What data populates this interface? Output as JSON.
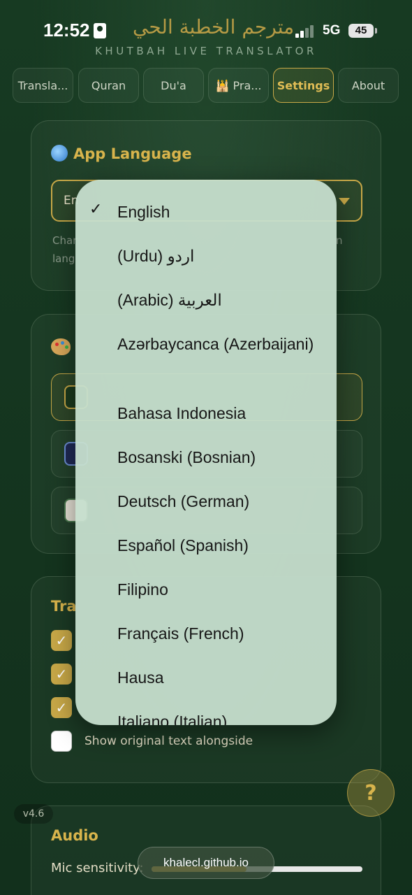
{
  "status_bar": {
    "time": "12:52",
    "network": "5G",
    "battery": "45",
    "app_title_arabic": "مترجم الخطبة الحي",
    "app_subtitle": "KHUTBAH LIVE TRANSLATOR"
  },
  "tabs": [
    {
      "label": "Transla..."
    },
    {
      "label": "Quran"
    },
    {
      "label": "Du'a"
    },
    {
      "label": "🕌 Pra..."
    },
    {
      "label": "Settings",
      "active": true
    },
    {
      "label": "About"
    }
  ],
  "app_language": {
    "title": "App Language",
    "selected": "En",
    "help_line1": "Char",
    "help_line1_end": "n",
    "help_line2": "lang"
  },
  "theme": {
    "title_fragment": "",
    "colors": [
      "#1c3a1e",
      "#1f2a55",
      "#e8e4d8"
    ]
  },
  "translation_display": {
    "title_fragment": "Tra",
    "options": [
      {
        "label": "",
        "checked": true
      },
      {
        "label": "",
        "checked": true
      },
      {
        "label": "",
        "checked": true
      },
      {
        "label": "Show original text alongside",
        "checked": false
      }
    ]
  },
  "audio": {
    "title": "Audio",
    "mic_label": "Mic sensitivity:",
    "mic_level": 0.45
  },
  "version": "v4.6",
  "help_button": "?",
  "browser": {
    "url": "khalecl.github.io"
  },
  "language_dropdown": {
    "checkmark": "✓",
    "options": [
      "English",
      "(Urdu) اردو",
      "(Arabic) العربية",
      "Azərbaycanca (Azerbaijani)",
      "Bahasa Indonesia",
      "Bosanski (Bosnian)",
      "Deutsch (German)",
      "Español (Spanish)",
      "Filipino",
      "Français (French)",
      "Hausa",
      "Italiano (Italian)"
    ],
    "selected_index": 0
  },
  "colors": {
    "accent": "#c9a948",
    "background": "#14351f",
    "dropdown_bg": "#c6decd"
  }
}
